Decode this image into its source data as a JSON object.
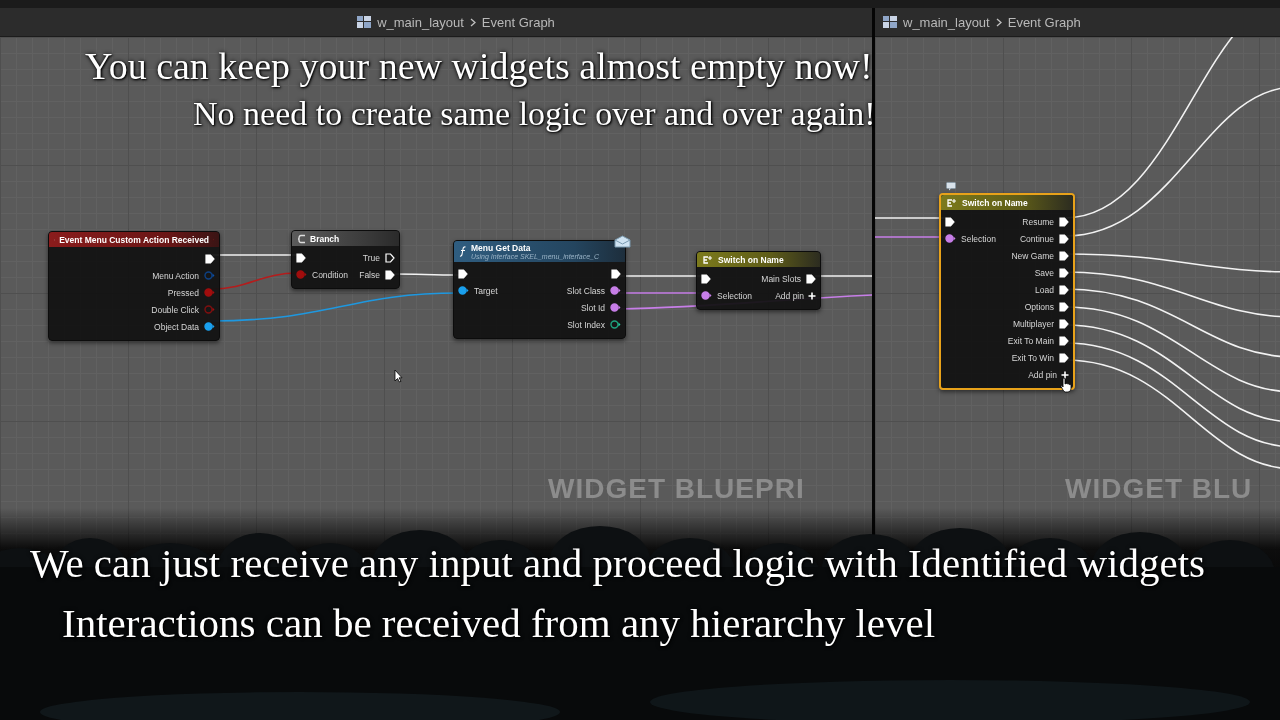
{
  "panels": [
    {
      "breadcrumb": {
        "asset": "w_main_layout",
        "graph": "Event Graph"
      },
      "graph_label": "WIDGET BLUEPRI",
      "nodes": [
        {
          "kind": "event",
          "title": "Event Menu Custom Action Received",
          "selected": false,
          "outputs": [
            {
              "kind": "exec",
              "connected": true
            },
            {
              "label": "Menu Action",
              "kind": "struct",
              "connected": false
            },
            {
              "label": "Pressed",
              "kind": "bool",
              "connected": true
            },
            {
              "label": "Double Click",
              "kind": "bool",
              "connected": false
            },
            {
              "label": "Object Data",
              "kind": "object",
              "connected": true
            }
          ]
        },
        {
          "kind": "branch",
          "title": "Branch",
          "selected": false,
          "inputs": [
            {
              "kind": "exec",
              "connected": true
            },
            {
              "label": "Condition",
              "kind": "bool",
              "connected": true
            }
          ],
          "outputs": [
            {
              "label": "True",
              "kind": "exec",
              "connected": false
            },
            {
              "label": "False",
              "kind": "exec",
              "connected": true
            }
          ]
        },
        {
          "kind": "function",
          "title": "Menu Get Data",
          "subtitle": "Using Interface SKEL_menu_interface_C",
          "selected": false,
          "inputs": [
            {
              "kind": "exec",
              "connected": true
            },
            {
              "label": "Target",
              "kind": "object",
              "connected": true
            }
          ],
          "outputs": [
            {
              "kind": "exec",
              "connected": true
            },
            {
              "label": "Slot Class",
              "kind": "name",
              "connected": true
            },
            {
              "label": "Slot Id",
              "kind": "name",
              "connected": true
            },
            {
              "label": "Slot Index",
              "kind": "int",
              "connected": false
            }
          ]
        },
        {
          "kind": "switch",
          "title": "Switch on Name",
          "selected": false,
          "inputs": [
            {
              "kind": "exec",
              "connected": true
            },
            {
              "label": "Selection",
              "kind": "name",
              "connected": true
            }
          ],
          "outputs": [
            {
              "label": "Main Slots",
              "kind": "exec",
              "connected": true
            }
          ],
          "add_pin": "Add pin"
        }
      ]
    },
    {
      "breadcrumb": {
        "asset": "w_main_layout",
        "graph": "Event Graph"
      },
      "graph_label": "WIDGET BLU",
      "nodes": [
        {
          "kind": "switch",
          "title": "Switch on Name",
          "selected": true,
          "inputs": [
            {
              "kind": "exec",
              "connected": true
            },
            {
              "label": "Selection",
              "kind": "name",
              "connected": true
            }
          ],
          "outputs": [
            {
              "label": "Resume",
              "kind": "exec",
              "connected": true
            },
            {
              "label": "Continue",
              "kind": "exec",
              "connected": true
            },
            {
              "label": "New Game",
              "kind": "exec",
              "connected": true
            },
            {
              "label": "Save",
              "kind": "exec",
              "connected": true
            },
            {
              "label": "Load",
              "kind": "exec",
              "connected": true
            },
            {
              "label": "Options",
              "kind": "exec",
              "connected": true
            },
            {
              "label": "Multiplayer",
              "kind": "exec",
              "connected": true
            },
            {
              "label": "Exit To Main",
              "kind": "exec",
              "connected": true
            },
            {
              "label": "Exit To Win",
              "kind": "exec",
              "connected": true
            }
          ],
          "add_pin": "Add pin"
        }
      ]
    }
  ],
  "captions_top": [
    "You can keep your new widgets almost empty now!",
    "No need to create same logic over and over again!"
  ],
  "captions_bottom": [
    "We can just receive any input and proceed logic with Identified widgets",
    "Interactions can be received from any hierarchy level"
  ]
}
